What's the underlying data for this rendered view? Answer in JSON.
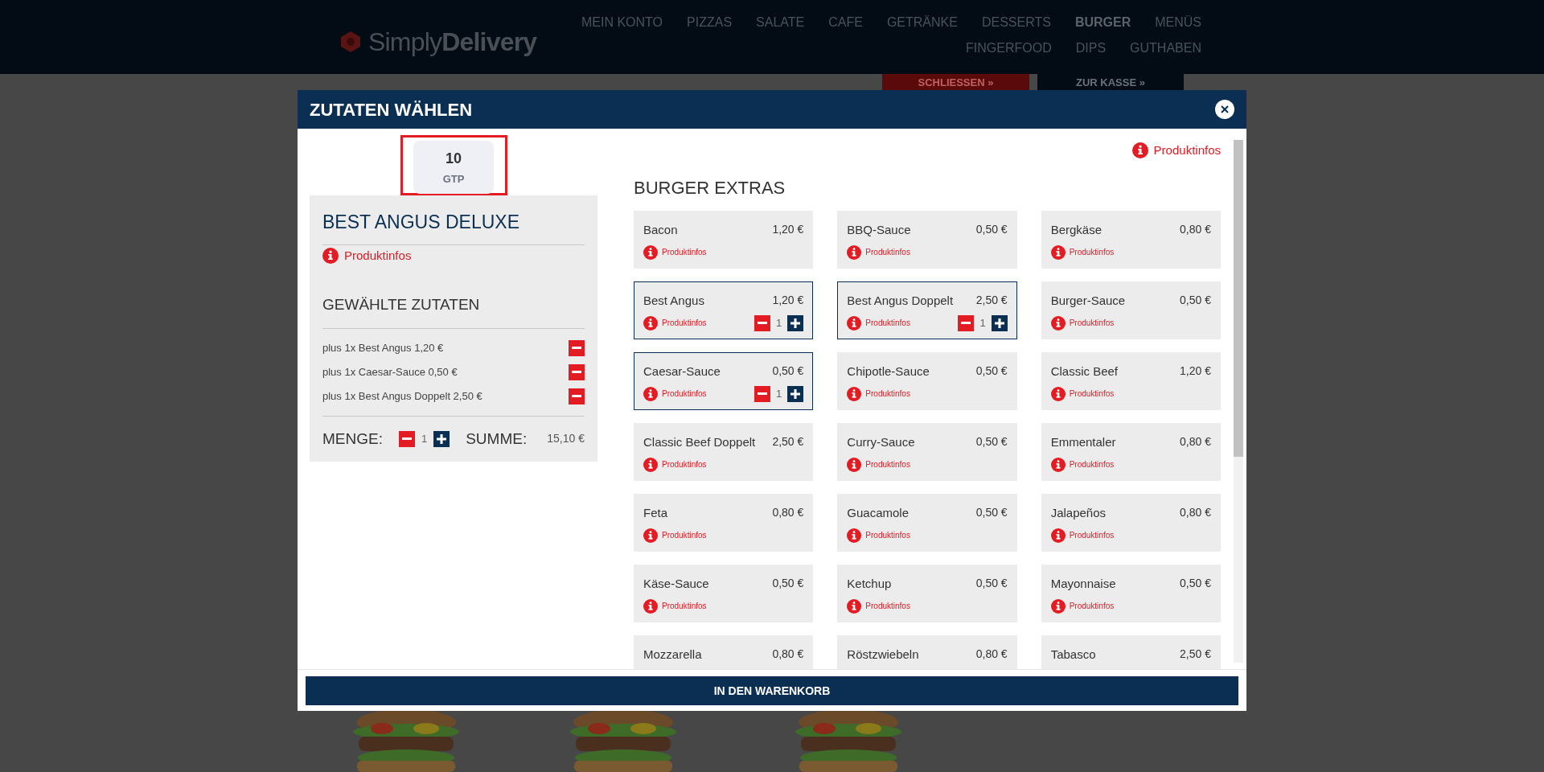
{
  "site": {
    "logo_light": "Simply",
    "logo_bold": "Delivery",
    "nav": [
      {
        "label": "MEIN KONTO",
        "selected": false
      },
      {
        "label": "PIZZAS",
        "selected": false
      },
      {
        "label": "SALATE",
        "selected": false
      },
      {
        "label": "CAFE",
        "selected": false
      },
      {
        "label": "GETRÄNKE",
        "selected": false
      },
      {
        "label": "DESSERTS",
        "selected": false
      },
      {
        "label": "BURGER",
        "selected": true
      },
      {
        "label": "MENÜS",
        "selected": false
      },
      {
        "label": "FINGERFOOD",
        "selected": false
      },
      {
        "label": "DIPS",
        "selected": false
      },
      {
        "label": "GUTHABEN",
        "selected": false
      }
    ],
    "close_button": "SCHLIESSEN »",
    "checkout_button": "ZUR KASSE »"
  },
  "modal": {
    "title": "ZUTATEN WÄHLEN",
    "badge": {
      "value": "10",
      "unit": "GTP"
    },
    "product": {
      "name": "BEST ANGUS DELUXE",
      "info": "Produktinfos"
    },
    "selected_heading": "GEWÄHLTE ZUTATEN",
    "selected_items": [
      "plus 1x Best Angus 1,20 €",
      "plus 1x Caesar-Sauce 0,50 €",
      "plus 1x Best Angus Doppelt 2,50 €"
    ],
    "quantity_label": "MENGE:",
    "quantity": "1",
    "sum_label": "SUMME:",
    "sum": "15,10 €",
    "info_link": "Produktinfos",
    "section_title": "BURGER EXTRAS",
    "extras": [
      {
        "name": "Bacon",
        "price": "1,20 €",
        "info": "Produktinfos",
        "selected": false
      },
      {
        "name": "BBQ-Sauce",
        "price": "0,50 €",
        "info": "Produktinfos",
        "selected": false
      },
      {
        "name": "Bergkäse",
        "price": "0,80 €",
        "info": "Produktinfos",
        "selected": false
      },
      {
        "name": "Best Angus",
        "price": "1,20 €",
        "info": "Produktinfos",
        "selected": true,
        "count": "1"
      },
      {
        "name": "Best Angus Doppelt",
        "price": "2,50 €",
        "info": "Produktinfos",
        "selected": true,
        "count": "1"
      },
      {
        "name": "Burger-Sauce",
        "price": "0,50 €",
        "info": "Produktinfos",
        "selected": false
      },
      {
        "name": "Caesar-Sauce",
        "price": "0,50 €",
        "info": "Produktinfos",
        "selected": true,
        "count": "1"
      },
      {
        "name": "Chipotle-Sauce",
        "price": "0,50 €",
        "info": "Produktinfos",
        "selected": false
      },
      {
        "name": "Classic Beef",
        "price": "1,20 €",
        "info": "Produktinfos",
        "selected": false
      },
      {
        "name": "Classic Beef Doppelt",
        "price": "2,50 €",
        "info": "Produktinfos",
        "selected": false
      },
      {
        "name": "Curry-Sauce",
        "price": "0,50 €",
        "info": "Produktinfos",
        "selected": false
      },
      {
        "name": "Emmentaler",
        "price": "0,80 €",
        "info": "Produktinfos",
        "selected": false
      },
      {
        "name": "Feta",
        "price": "0,80 €",
        "info": "Produktinfos",
        "selected": false
      },
      {
        "name": "Guacamole",
        "price": "0,50 €",
        "info": "Produktinfos",
        "selected": false
      },
      {
        "name": "Jalapeños",
        "price": "0,80 €",
        "info": "Produktinfos",
        "selected": false
      },
      {
        "name": "Käse-Sauce",
        "price": "0,50 €",
        "info": "Produktinfos",
        "selected": false
      },
      {
        "name": "Ketchup",
        "price": "0,50 €",
        "info": "Produktinfos",
        "selected": false
      },
      {
        "name": "Mayonnaise",
        "price": "0,50 €",
        "info": "Produktinfos",
        "selected": false
      },
      {
        "name": "Mozzarella",
        "price": "0,80 €",
        "selected": false
      },
      {
        "name": "Röstzwiebeln",
        "price": "0,80 €",
        "selected": false
      },
      {
        "name": "Tabasco",
        "price": "2,50 €",
        "selected": false
      }
    ],
    "submit": "IN DEN WARENKORB"
  }
}
